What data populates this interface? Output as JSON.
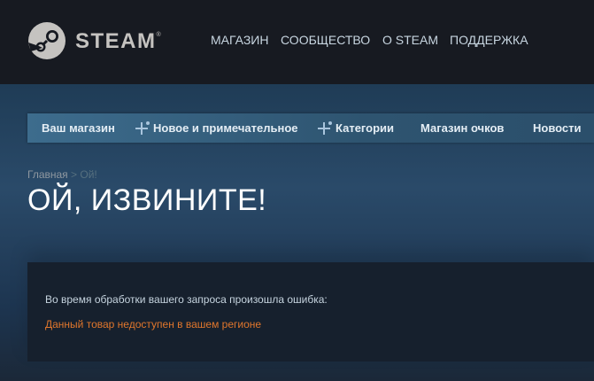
{
  "header": {
    "logo_text": "STEAM",
    "logo_mark": "®",
    "nav": [
      "МАГАЗИН",
      "СООБЩЕСТВО",
      "О STEAM",
      "ПОДДЕРЖКА"
    ]
  },
  "store_nav": {
    "items": [
      {
        "label": "Ваш магазин",
        "has_plus": false
      },
      {
        "label": "Новое и примечательное",
        "has_plus": true
      },
      {
        "label": "Категории",
        "has_plus": true
      },
      {
        "label": "Магазин очков",
        "has_plus": false
      },
      {
        "label": "Новости",
        "has_plus": false
      }
    ]
  },
  "breadcrumb": {
    "home": "Главная",
    "separator": ">",
    "current": "Ой!"
  },
  "page_title": "ОЙ, ИЗВИНИТЕ!",
  "error": {
    "message": "Во время обработки вашего запроса произошла ошибка:",
    "detail": "Данный товар недоступен в вашем регионе"
  },
  "colors": {
    "header_bg": "#171a21",
    "accent_orange": "#e0762c",
    "nav_text": "#c7d5e0"
  },
  "icons": {
    "logo": "steam-logo-icon",
    "plus": "plus-icon"
  }
}
